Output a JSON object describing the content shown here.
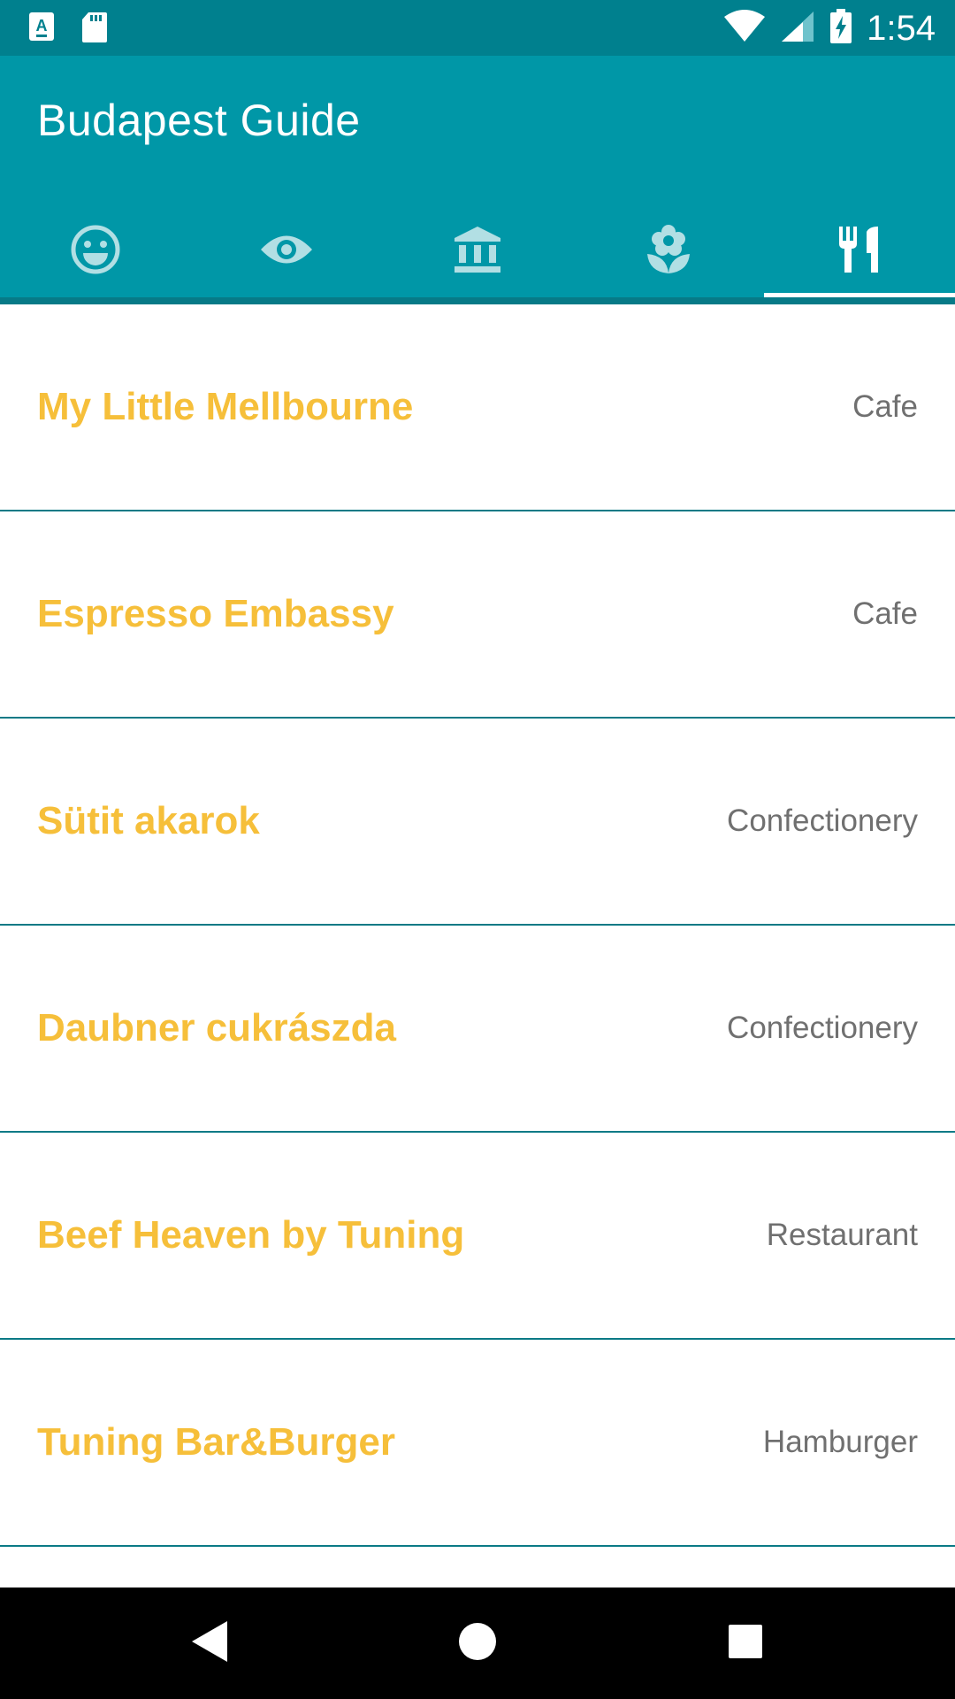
{
  "status_bar": {
    "time": "1:54",
    "icons": [
      "a-notification-icon",
      "sd-card-icon",
      "wifi-icon",
      "signal-icon",
      "battery-charging-icon"
    ]
  },
  "app_bar": {
    "title": "Budapest Guide",
    "background_color": "#0097a7"
  },
  "tabs": [
    {
      "icon": "smiley-icon",
      "selected": false
    },
    {
      "icon": "eye-icon",
      "selected": false
    },
    {
      "icon": "museum-icon",
      "selected": false
    },
    {
      "icon": "flower-icon",
      "selected": false
    },
    {
      "icon": "restaurant-icon",
      "selected": true
    }
  ],
  "places": [
    {
      "name": "My Little Mellbourne",
      "category": "Cafe"
    },
    {
      "name": "Espresso Embassy",
      "category": "Cafe"
    },
    {
      "name": "Sütit akarok",
      "category": "Confectionery"
    },
    {
      "name": "Daubner cukrászda",
      "category": "Confectionery"
    },
    {
      "name": "Beef Heaven by Tuning",
      "category": "Restaurant"
    },
    {
      "name": "Tuning Bar&Burger",
      "category": "Hamburger"
    }
  ],
  "colors": {
    "name_text": "#f6bf3a",
    "category_text": "#707070",
    "divider": "#0b7a86"
  },
  "nav_bar": {
    "buttons": [
      "back-icon",
      "home-icon",
      "recents-icon"
    ]
  }
}
